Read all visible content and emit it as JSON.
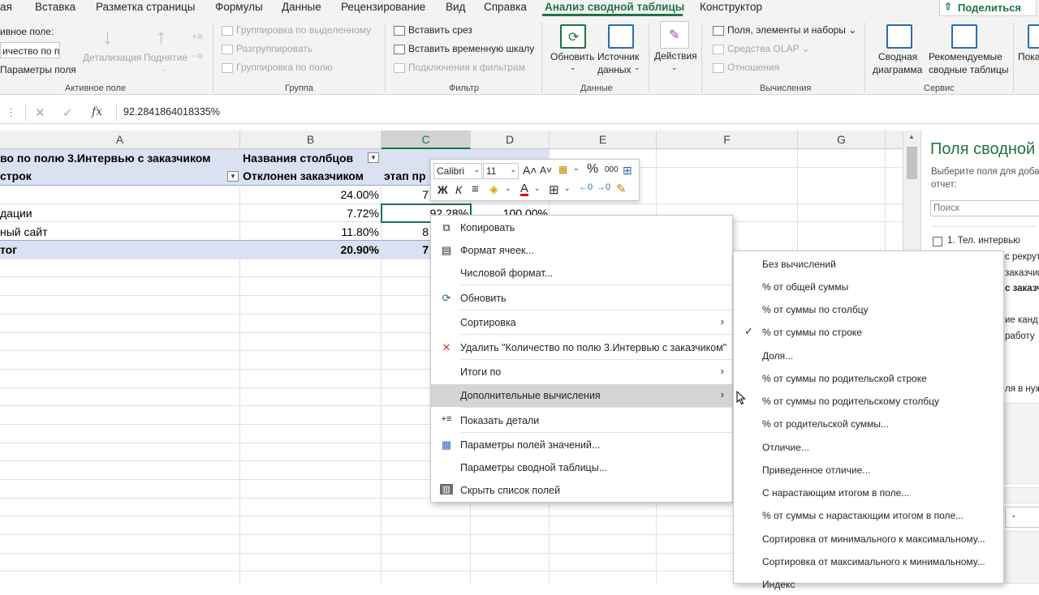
{
  "ribbon": {
    "tabs": [
      "Вставка",
      "Разметка страницы",
      "Формулы",
      "Данные",
      "Рецензирование",
      "Вид",
      "Справка",
      "Анализ сводной таблицы",
      "Конструктор"
    ],
    "tab_first_partial": "ая",
    "share": "Поделиться",
    "active_field": {
      "label": "ивное поле:",
      "value": "ичество по по",
      "drilldown": "Детализация",
      "drillup": "Поднятие",
      "field_params": "Параметры поля",
      "group_label": "Активное поле"
    },
    "group": {
      "items": [
        "Группировка по выделенному",
        "Разгруппировать",
        "Группировка по полю"
      ],
      "label": "Группа"
    },
    "filter": {
      "items": [
        "Вставить срез",
        "Вставить временную шкалу",
        "Подключения к фильтрам"
      ],
      "label": "Фильтр"
    },
    "data": {
      "refresh": "Обновить",
      "source_1": "Источник",
      "source_2": "данных",
      "label": "Данные"
    },
    "actions": "Действия",
    "calc": {
      "items": [
        "Поля, элементы и наборы",
        "Средства OLAP",
        "Отношения"
      ],
      "label": "Вычисления"
    },
    "service": {
      "chart_1": "Сводная",
      "chart_2": "диаграмма",
      "rec_1": "Рекомендуемые",
      "rec_2": "сводные таблицы",
      "show_partial": "Пока",
      "label": "Сервис"
    }
  },
  "formula_bar": {
    "fx": "fx",
    "value": "92.2841864018335%"
  },
  "columns": [
    "A",
    "B",
    "C",
    "D",
    "E",
    "F",
    "G"
  ],
  "sheet": {
    "a1": "во по полю 3.Интервью с заказчиком",
    "b1": "Названия столбцов",
    "a2": "строк",
    "b2": "Отклонен заказчиком",
    "c2": "этап пр",
    "b3": "24.00%",
    "c3": "7",
    "a4": "дации",
    "b4": "7.72%",
    "c4": "92.28%",
    "d4": "100.00%",
    "a5": "ный сайт",
    "b5": "11.80%",
    "c5": "8",
    "a6": "тог",
    "b6": "20.90%",
    "c6": "7"
  },
  "mini_toolbar": {
    "font": "Calibri",
    "size": "11",
    "bold": "Ж",
    "italic": "К",
    "percent": "%",
    "thousands": "000"
  },
  "context_menu": [
    {
      "label": "Копировать",
      "icon": "copy-icon",
      "glyph": "⧉"
    },
    {
      "label": "Формат ячеек...",
      "icon": "format-cells-icon",
      "glyph": "▤"
    },
    {
      "label": "Числовой формат...",
      "icon": "",
      "glyph": ""
    },
    {
      "label": "Обновить",
      "icon": "refresh-icon",
      "glyph": "⟳"
    },
    {
      "label": "Сортировка",
      "icon": "",
      "glyph": "",
      "submenu": true
    },
    {
      "label": "Удалить \"Количество по полю 3.Интервью с заказчиком\"",
      "icon": "delete-icon",
      "glyph": "✕"
    },
    {
      "label": "Итоги по",
      "icon": "",
      "glyph": "",
      "submenu": true
    },
    {
      "label": "Дополнительные вычисления",
      "icon": "",
      "glyph": "",
      "submenu": true,
      "highlight": true
    },
    {
      "label": "Показать детали",
      "icon": "show-details-icon",
      "glyph": "+≡"
    },
    {
      "label": "Параметры полей значений...",
      "icon": "value-field-settings-icon",
      "glyph": "▦"
    },
    {
      "label": "Параметры сводной таблицы...",
      "icon": "",
      "glyph": ""
    },
    {
      "label": "Скрыть список полей",
      "icon": "field-list-icon",
      "glyph": "▥"
    }
  ],
  "submenu": [
    {
      "label": "Без вычислений"
    },
    {
      "label": "% от общей суммы"
    },
    {
      "label": "% от суммы по столбцу"
    },
    {
      "label": "% от суммы по строке",
      "checked": true
    },
    {
      "label": "Доля..."
    },
    {
      "label": "% от суммы по родительской строке"
    },
    {
      "label": "% от суммы по родительскому столбцу"
    },
    {
      "label": "% от родительской суммы..."
    },
    {
      "label": "Отличие..."
    },
    {
      "label": "Приведенное отличие..."
    },
    {
      "label": "С нарастающим итогом в поле..."
    },
    {
      "label": "% от суммы с нарастающим итогом в поле..."
    },
    {
      "label": "Сортировка от минимального к максимальному..."
    },
    {
      "label": "Сортировка от максимального к минимальному..."
    },
    {
      "label": "Индекс"
    }
  ],
  "field_pane": {
    "title": "Поля сводной",
    "subtitle_1": "Выберите поля для доба",
    "subtitle_2": "отчет:",
    "search_placeholder": "Поиск",
    "item_1": "1. Тел. интервью",
    "partial_1": "с рекрути",
    "partial_2": "заказчик",
    "partial_3": "с заказч",
    "partial_4": "ие канд",
    "partial_5": "работу",
    "partial_6": "ля в нуж"
  }
}
